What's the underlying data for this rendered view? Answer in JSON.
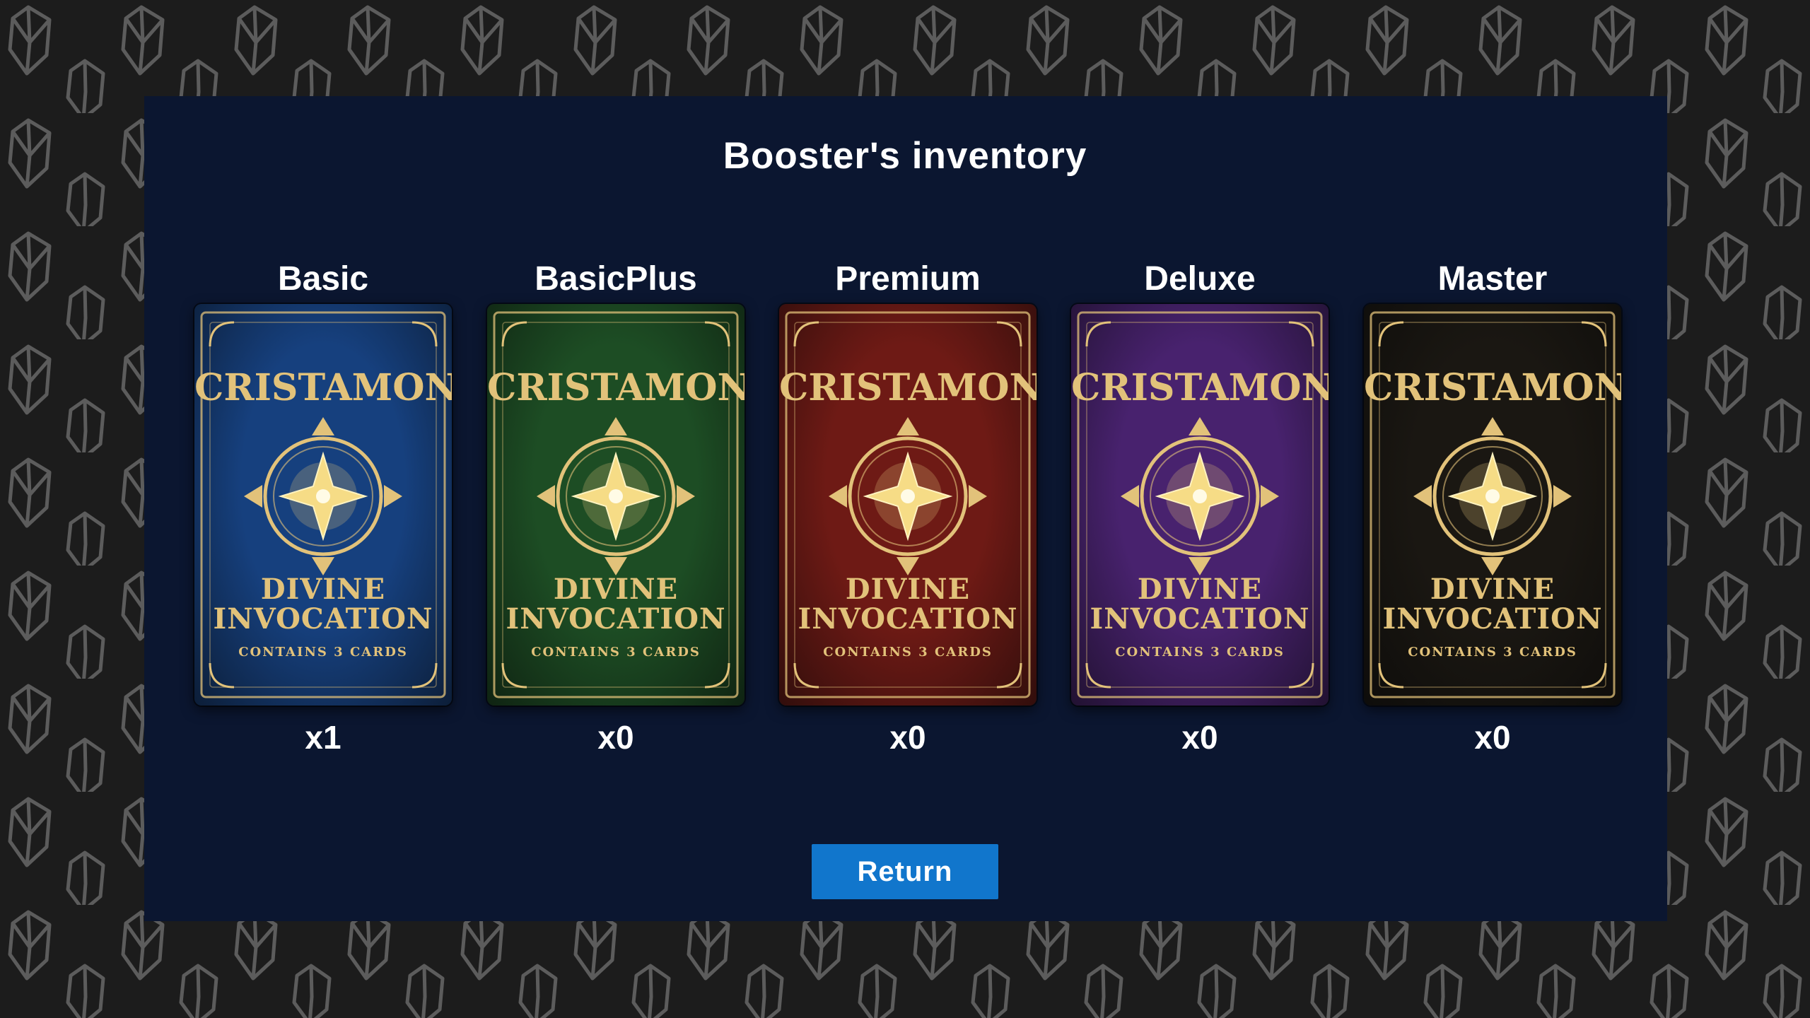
{
  "title": "Booster's inventory",
  "boosters": [
    {
      "name": "Basic",
      "count": "x1",
      "color": "#16407e",
      "brand": "CRISTAMON",
      "line1": "DIVINE",
      "line2": "INVOCATION",
      "sub": "CONTAINS 3 CARDS"
    },
    {
      "name": "BasicPlus",
      "count": "x0",
      "color": "#1d4d24",
      "brand": "CRISTAMON",
      "line1": "DIVINE",
      "line2": "INVOCATION",
      "sub": "CONTAINS 3 CARDS"
    },
    {
      "name": "Premium",
      "count": "x0",
      "color": "#6e1a15",
      "brand": "CRISTAMON",
      "line1": "DIVINE",
      "line2": "INVOCATION",
      "sub": "CONTAINS 3 CARDS"
    },
    {
      "name": "Deluxe",
      "count": "x0",
      "color": "#48226e",
      "brand": "CRISTAMON",
      "line1": "DIVINE",
      "line2": "INVOCATION",
      "sub": "CONTAINS 3 CARDS"
    },
    {
      "name": "Master",
      "count": "x0",
      "color": "#1a1712",
      "brand": "CRISTAMON",
      "line1": "DIVINE",
      "line2": "INVOCATION",
      "sub": "CONTAINS 3 CARDS"
    }
  ],
  "return_label": "Return",
  "colors": {
    "background": "#1c1c1c",
    "panel": "#0b1630",
    "gold": "#e2c27a",
    "button": "#1176cc"
  },
  "icons": {
    "background": "crystal-pattern",
    "pack_emblem": "four-point-star-emblem"
  }
}
